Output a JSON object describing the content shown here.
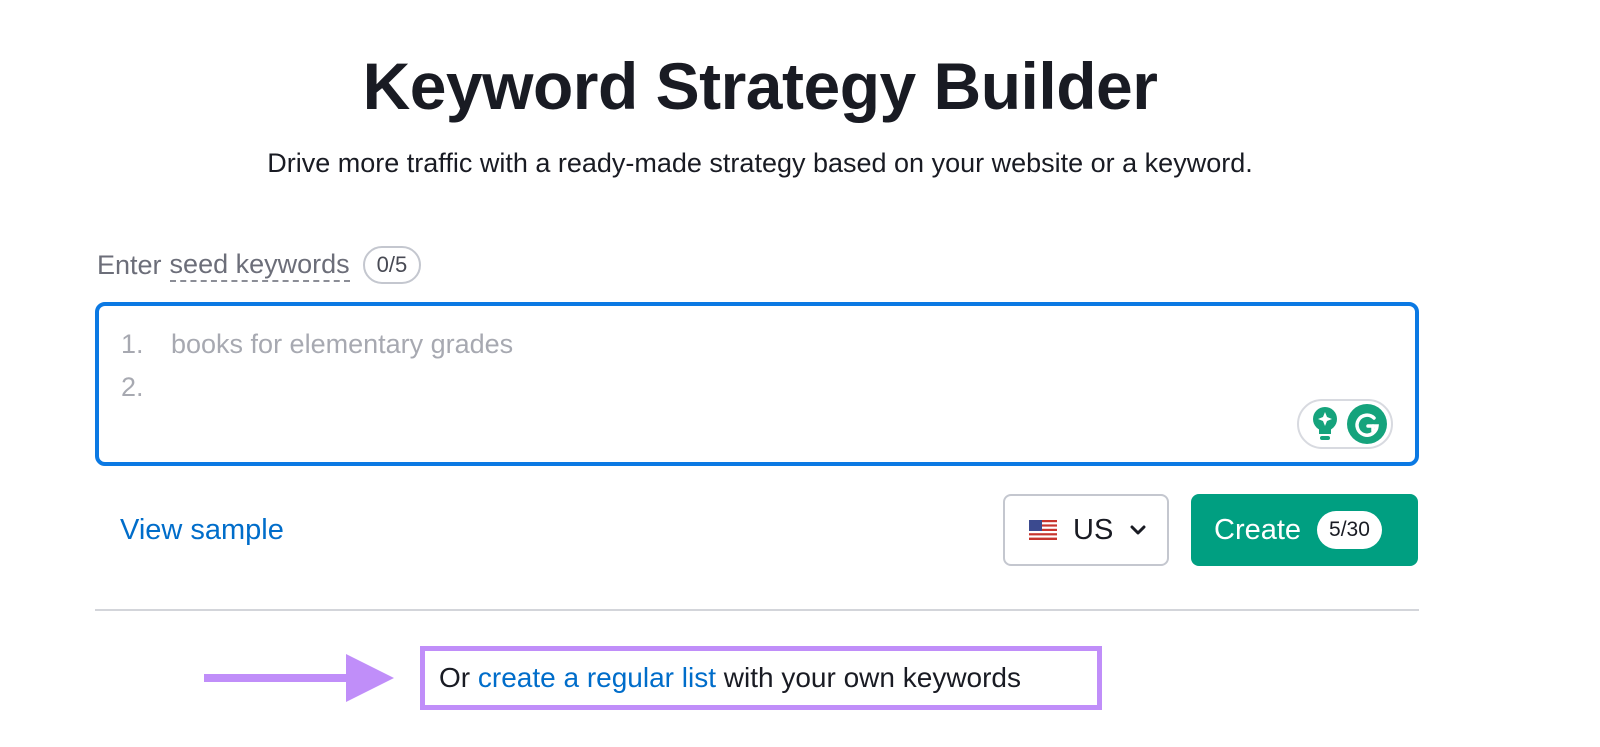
{
  "header": {
    "title": "Keyword Strategy Builder",
    "subtitle": "Drive more traffic with a ready-made strategy based on your website or a keyword."
  },
  "seed_input": {
    "label_prefix": "Enter",
    "label_term": "seed keywords",
    "counter": "0/5",
    "lines": [
      {
        "number": "1.",
        "placeholder": "books for elementary grades"
      },
      {
        "number": "2.",
        "placeholder": ""
      }
    ],
    "grammarly_icons": [
      "lightbulb-icon",
      "grammarly-g-icon"
    ]
  },
  "actions": {
    "view_sample": "View sample",
    "country": {
      "flag": "us-flag-icon",
      "selected": "US"
    },
    "create": {
      "label": "Create",
      "count": "5/30"
    }
  },
  "footer": {
    "prefix": "Or ",
    "link": "create a regular list",
    "suffix": " with your own keywords"
  },
  "colors": {
    "accent_blue": "#0b79e3",
    "link_blue": "#006dca",
    "create_green": "#009f81",
    "annotation_purple": "#c08ef9"
  }
}
